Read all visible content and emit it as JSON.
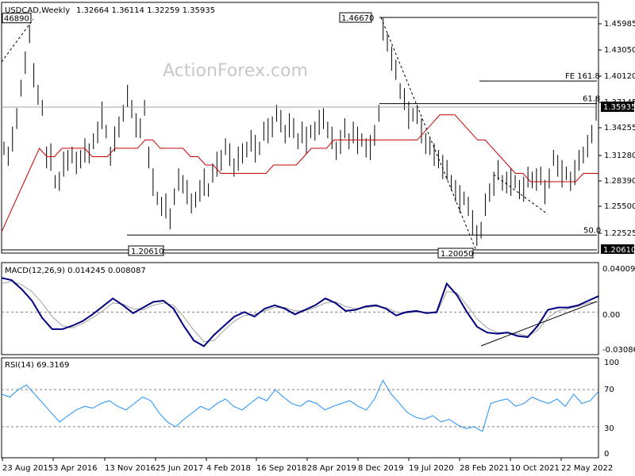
{
  "header": {
    "symbol": "USDCAD,Weekly",
    "ohlc": "1.32664 1.36114 1.32259 1.35935"
  },
  "watermark": "ActionForex.com",
  "colors": {
    "price": "#000000",
    "ema": "#cc0000",
    "macd": "#000080",
    "signal": "#a0a0a0",
    "rsi": "#1e90ff",
    "grid": "#808080"
  },
  "chart_data": [
    {
      "type": "line",
      "panel": "price",
      "title": "USDCAD,Weekly",
      "ylim": [
        1.1845,
        1.4848
      ],
      "x_labels": [
        "23 Aug 2015",
        "3 Apr 2016",
        "13 Nov 2016",
        "25 Jun 2017",
        "4 Feb 2018",
        "16 Sep 2018",
        "28 Apr 2019",
        "8 Dec 2019",
        "19 Jul 2020",
        "28 Feb 2021",
        "10 Oct 2021",
        "22 May 2022"
      ],
      "y_ticks": [
        "1.45985",
        "1.43050",
        "1.40120",
        "1.37145",
        "1.34255",
        "1.31280",
        "1.28390",
        "1.25500",
        "1.22525"
      ],
      "current_price": "1.35935",
      "series": [
        {
          "key": "close",
          "values": [
            1.31,
            1.3,
            1.32,
            1.35,
            1.38,
            1.41,
            1.45,
            1.4,
            1.37,
            1.36,
            1.3,
            1.3,
            1.27,
            1.27,
            1.29,
            1.3,
            1.3,
            1.29,
            1.3,
            1.31,
            1.3,
            1.32,
            1.33,
            1.35,
            1.33,
            1.3,
            1.32,
            1.34,
            1.35,
            1.37,
            1.36,
            1.34,
            1.33,
            1.36,
            1.3,
            1.27,
            1.25,
            1.24,
            1.24,
            1.23,
            1.25,
            1.27,
            1.27,
            1.26,
            1.24,
            1.25,
            1.26,
            1.27,
            1.26,
            1.28,
            1.29,
            1.3,
            1.31,
            1.3,
            1.29,
            1.3,
            1.3,
            1.31,
            1.32,
            1.31,
            1.31,
            1.33,
            1.33,
            1.34,
            1.35,
            1.34,
            1.33,
            1.34,
            1.33,
            1.32,
            1.33,
            1.32,
            1.33,
            1.33,
            1.34,
            1.35,
            1.33,
            1.32,
            1.31,
            1.32,
            1.33,
            1.32,
            1.33,
            1.32,
            1.32,
            1.31,
            1.31,
            1.33,
            1.35,
            1.45,
            1.44,
            1.42,
            1.4,
            1.38,
            1.37,
            1.35,
            1.35,
            1.35,
            1.33,
            1.32,
            1.31,
            1.3,
            1.3,
            1.29,
            1.28,
            1.27,
            1.26,
            1.25,
            1.25,
            1.24,
            1.22,
            1.21,
            1.21,
            1.24,
            1.26,
            1.27,
            1.28,
            1.27,
            1.27,
            1.27,
            1.27,
            1.26,
            1.26,
            1.28,
            1.27,
            1.27,
            1.28,
            1.26,
            1.27,
            1.3,
            1.29,
            1.28,
            1.28,
            1.27,
            1.28,
            1.3,
            1.3,
            1.31,
            1.33,
            1.36
          ]
        },
        {
          "key": "ema",
          "values": [
            1.21,
            1.23,
            1.25,
            1.27,
            1.29,
            1.31,
            1.3,
            1.3,
            1.31,
            1.31,
            1.31,
            1.31,
            1.3,
            1.3,
            1.3,
            1.31,
            1.31,
            1.31,
            1.31,
            1.32,
            1.32,
            1.31,
            1.31,
            1.31,
            1.31,
            1.3,
            1.3,
            1.29,
            1.29,
            1.28,
            1.28,
            1.28,
            1.28,
            1.28,
            1.28,
            1.28,
            1.29,
            1.29,
            1.29,
            1.29,
            1.3,
            1.31,
            1.31,
            1.31,
            1.32,
            1.32,
            1.32,
            1.32,
            1.32,
            1.32,
            1.32,
            1.32,
            1.32,
            1.32,
            1.32,
            1.32,
            1.33,
            1.34,
            1.35,
            1.35,
            1.35,
            1.34,
            1.33,
            1.32,
            1.32,
            1.31,
            1.3,
            1.29,
            1.28,
            1.28,
            1.27,
            1.27,
            1.27,
            1.27,
            1.27,
            1.27,
            1.27,
            1.28,
            1.28,
            1.28
          ]
        }
      ],
      "levels": [
        {
          "label": "1.46670",
          "value": 1.4667
        },
        {
          "label": "46890",
          "value": 1.4689
        },
        {
          "label": "FE 161.8",
          "value": 1.3906
        },
        {
          "label": "61.8",
          "value": 1.3635
        },
        {
          "label": "50.0",
          "value": 1.2061
        },
        {
          "label": "1.20610",
          "value": 1.2061
        },
        {
          "label": "1.20050",
          "value": 1.2005
        }
      ]
    },
    {
      "type": "line",
      "panel": "macd",
      "title": "MACD(12,26,9) 0.014245 0.008087",
      "ylim": [
        -0.036,
        0.04
      ],
      "y_ticks": [
        "0.040094",
        "0.00",
        "-0.03086"
      ],
      "series": [
        {
          "key": "macd",
          "values": [
            0.03,
            0.028,
            0.02,
            0.01,
            -0.005,
            -0.015,
            -0.015,
            -0.012,
            -0.008,
            -0.002,
            0.005,
            0.012,
            0.006,
            -0.001,
            0.004,
            0.009,
            0.01,
            0.003,
            -0.012,
            -0.025,
            -0.03,
            -0.02,
            -0.012,
            -0.004,
            0.0,
            -0.004,
            0.003,
            0.006,
            0.003,
            -0.002,
            0.002,
            0.006,
            0.012,
            0.008,
            0.001,
            0.002,
            0.005,
            0.006,
            0.003,
            -0.003,
            0.0,
            0.001,
            -0.001,
            0.0,
            0.025,
            0.015,
            0.0,
            -0.013,
            -0.018,
            -0.019,
            -0.018,
            -0.021,
            -0.022,
            -0.012,
            0.002,
            0.004,
            0.004,
            0.006,
            0.01,
            0.014
          ]
        },
        {
          "key": "signal",
          "values": [
            0.025,
            0.027,
            0.024,
            0.018,
            0.008,
            -0.004,
            -0.012,
            -0.014,
            -0.01,
            -0.005,
            0.001,
            0.008,
            0.007,
            0.003,
            0.002,
            0.006,
            0.008,
            0.006,
            -0.004,
            -0.016,
            -0.026,
            -0.025,
            -0.016,
            -0.008,
            -0.003,
            -0.002,
            0.001,
            0.004,
            0.004,
            0.001,
            0.001,
            0.004,
            0.008,
            0.009,
            0.005,
            0.003,
            0.004,
            0.005,
            0.004,
            0.0,
            -0.001,
            0.0,
            0.0,
            -0.001,
            0.018,
            0.017,
            0.006,
            -0.006,
            -0.014,
            -0.018,
            -0.018,
            -0.019,
            -0.021,
            -0.016,
            -0.005,
            0.001,
            0.003,
            0.005,
            0.008,
            0.009
          ]
        }
      ]
    },
    {
      "type": "line",
      "panel": "rsi",
      "title": "RSI(14) 69.3169",
      "ylim": [
        0,
        100
      ],
      "y_ticks": [
        "100",
        "70",
        "30",
        "0"
      ],
      "series": [
        {
          "key": "rsi",
          "values": [
            65,
            62,
            70,
            75,
            65,
            55,
            45,
            35,
            42,
            48,
            52,
            50,
            55,
            58,
            52,
            48,
            55,
            62,
            58,
            45,
            35,
            30,
            38,
            45,
            52,
            48,
            55,
            60,
            52,
            48,
            55,
            62,
            58,
            70,
            62,
            55,
            52,
            58,
            55,
            48,
            52,
            55,
            58,
            52,
            48,
            60,
            80,
            65,
            55,
            45,
            40,
            38,
            42,
            35,
            38,
            32,
            28,
            30,
            25,
            55,
            58,
            60,
            52,
            55,
            62,
            58,
            55,
            60,
            52,
            65,
            55,
            58,
            68
          ]
        }
      ]
    }
  ]
}
